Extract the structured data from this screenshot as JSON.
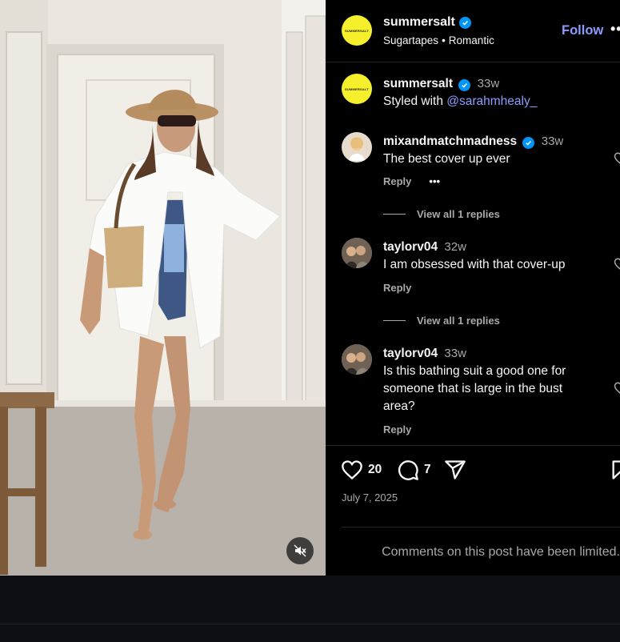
{
  "post": {
    "account": "summersalt",
    "avatar_text": "SUMMERSALT",
    "audio": "Sugartapes",
    "audio_sep": "•",
    "audio_title": "Romantic",
    "follow_label": "Follow",
    "more_label": "••"
  },
  "caption": {
    "user": "summersalt",
    "time": "33w",
    "text": "Styled with ",
    "mention": "@sarahmhealy_"
  },
  "comments": [
    {
      "user": "mixandmatchmadness",
      "time": "33w",
      "text": "The best cover up ever",
      "reply_label": "Reply",
      "options_label": "•••",
      "view_replies": "View all 1 replies",
      "verified": true
    },
    {
      "user": "taylorv04",
      "time": "32w",
      "text": "I am obsessed with that cover-up",
      "reply_label": "Reply",
      "view_replies": "View all 1 replies"
    },
    {
      "user": "taylorv04",
      "time": "33w",
      "text": "Is this bathing suit a good one for someone that is large in the bust area?",
      "reply_label": "Reply"
    }
  ],
  "actions": {
    "likes": "20",
    "comments": "7"
  },
  "date": "July 7, 2025",
  "limited_notice": "Comments on this post have been limited.",
  "colors": {
    "background": "#0c1014",
    "panel": "#000000",
    "accent_link": "#8c9cff",
    "verified": "#0095f6",
    "avatar_brand": "#f6ef2b",
    "muted_text": "#a8a8a8"
  },
  "icons": [
    "verified-icon",
    "heart-icon",
    "comment-icon",
    "share-icon",
    "bookmark-icon",
    "mute-icon"
  ]
}
